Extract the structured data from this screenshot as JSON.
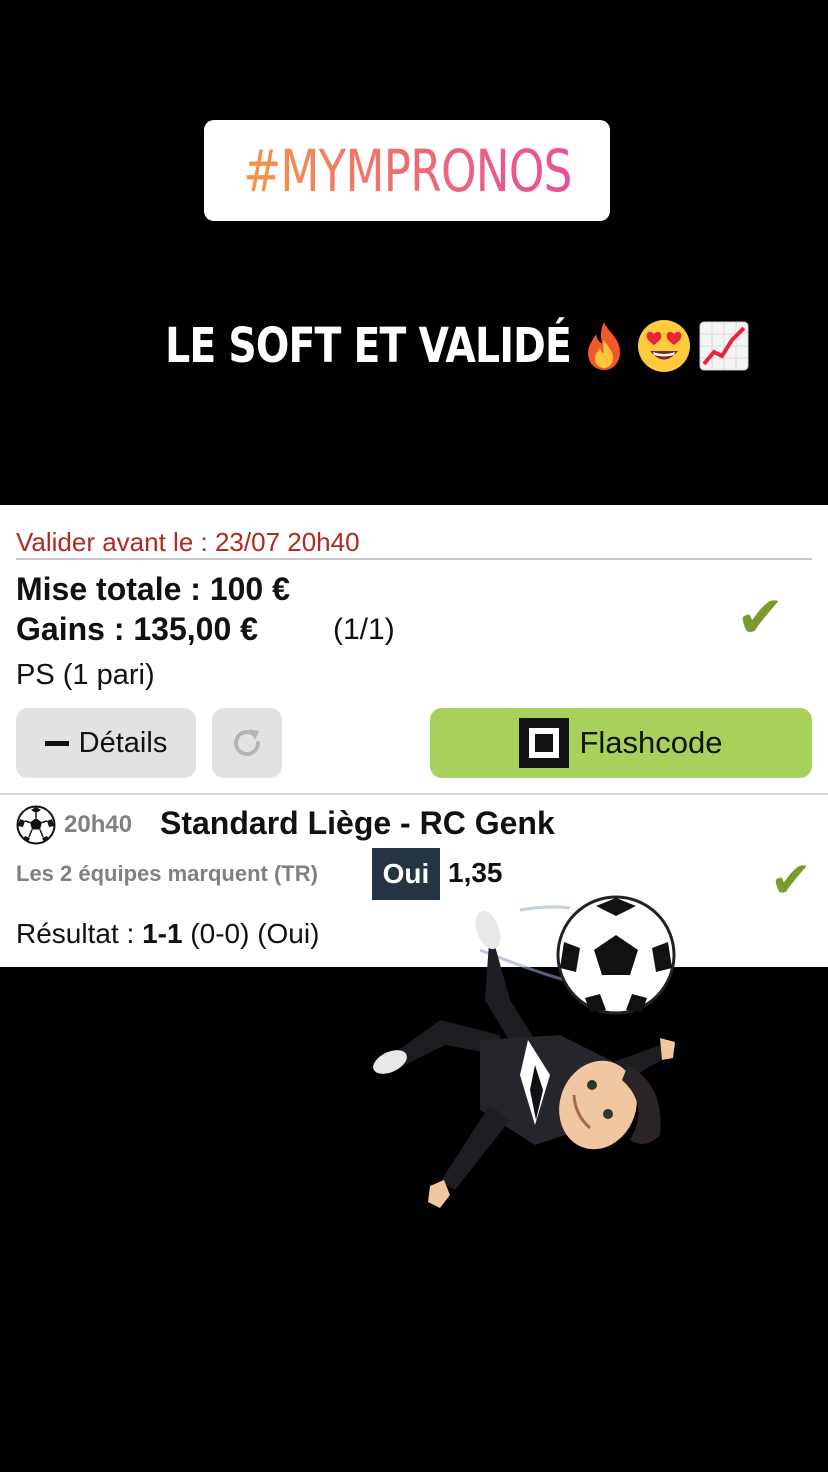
{
  "story": {
    "hashtag": "#MYMPRONOS",
    "caption": "LE SOFT ET VALIDÉ"
  },
  "bet": {
    "validate_label": "Valider avant le : 23/07 20h40",
    "stake_label": "Mise totale : 100 €",
    "gains_label": "Gains : 135,00 €",
    "count_label": "(1/1)",
    "type_label": "PS (1 pari)",
    "check_icon": "✔",
    "details_button": "Détails",
    "flashcode_button": "Flashcode"
  },
  "match": {
    "time": "20h40",
    "title": "Standard Liège - RC Genk",
    "market": "Les 2 équipes marquent (TR)",
    "selection": "Oui",
    "odds": "1,35",
    "result_prefix": "Résultat : ",
    "result_score": "1-1",
    "result_suffix": " (0-0) (Oui)",
    "check_icon": "✔"
  },
  "colors": {
    "validate_red": "#b1291f",
    "flash_green": "#a8d15b",
    "check_green": "#7c9b2f",
    "badge_navy": "#253445"
  }
}
